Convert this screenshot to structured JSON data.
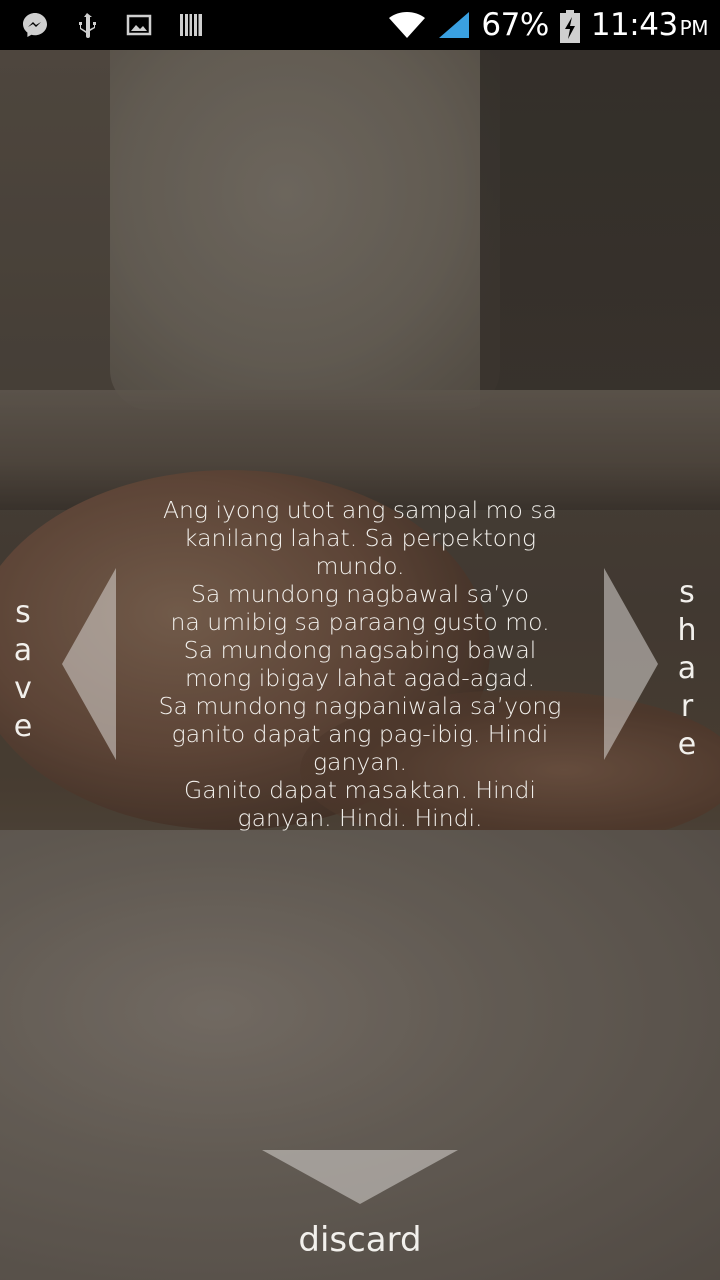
{
  "status_bar": {
    "icons_left": [
      "messenger-icon",
      "usb-icon",
      "gallery-icon",
      "barcode-icon"
    ],
    "icons_right": [
      "wifi-icon",
      "signal-icon",
      "battery-charging-icon"
    ],
    "battery_percent": "67%",
    "time": "11:43",
    "ampm": "PM"
  },
  "quote": {
    "lines": [
      "Ang iyong utot ang sampal mo sa",
      "kanilang lahat. Sa perpektong",
      "mundo.",
      "Sa mundong nagbawal sa’yo",
      "na umibig sa paraang gusto mo.",
      "Sa mundong nagsabing bawal",
      "mong ibigay lahat agad-agad.",
      "Sa mundong nagpaniwala sa’yong",
      "ganito dapat ang pag-ibig. Hindi",
      "ganyan.",
      "Ganito dapat masaktan. Hindi",
      "ganyan. Hindi. Hindi."
    ]
  },
  "actions": {
    "save_label": "save",
    "share_label": "share",
    "discard_label": "discard"
  },
  "colors": {
    "text": "#f2f0ec",
    "arrow": "#d9d6d1",
    "status_bar": "#000000"
  }
}
